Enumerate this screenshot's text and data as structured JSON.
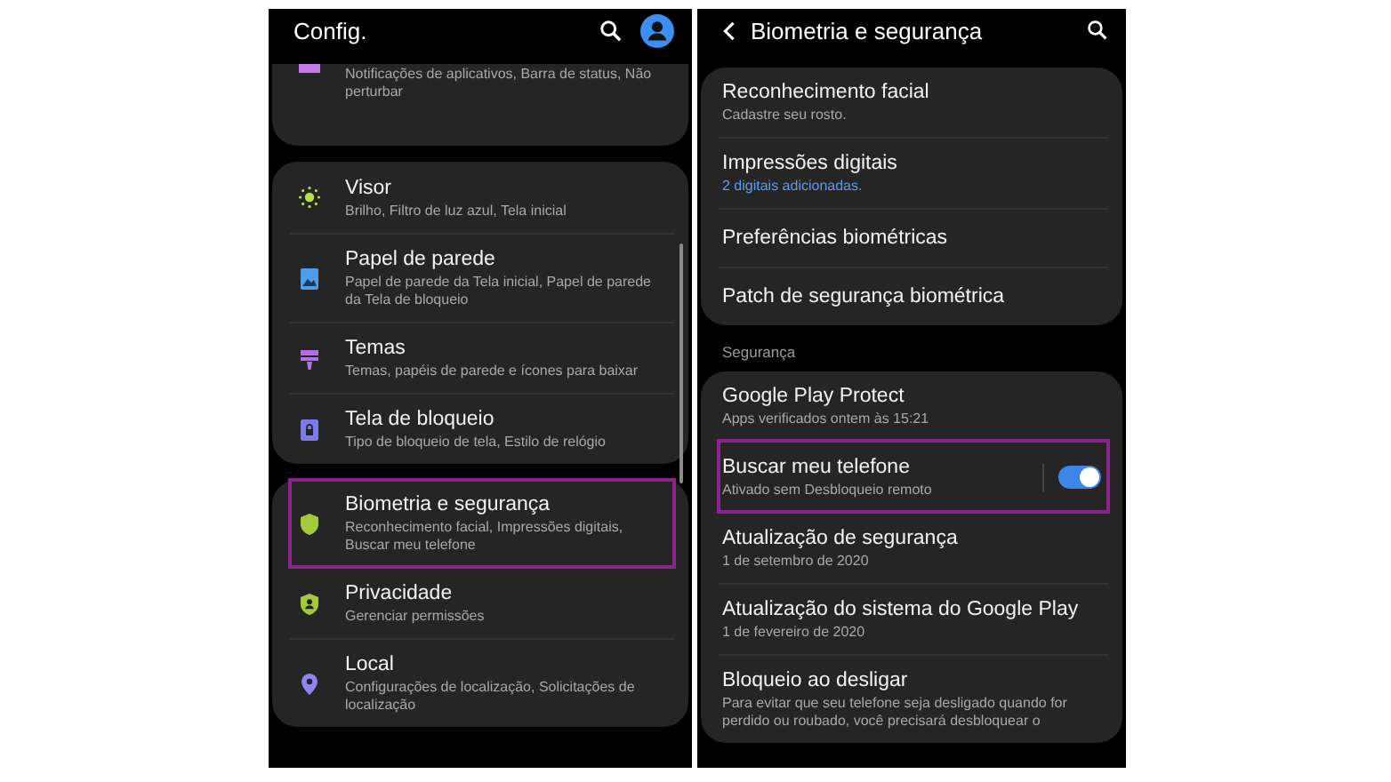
{
  "left": {
    "title": "Config.",
    "cards": [
      {
        "items": [
          {
            "kind": "folder",
            "color": "#c47be8",
            "subtitle": "Notificações de aplicativos, Barra de status, Não perturbar",
            "highlighted": false
          }
        ]
      },
      {
        "items": [
          {
            "kind": "sun",
            "color": "#b9e04a",
            "title": "Visor",
            "subtitle": "Brilho, Filtro de luz azul, Tela inicial",
            "highlighted": false
          },
          {
            "kind": "image",
            "color": "#4d9de8",
            "title": "Papel de parede",
            "subtitle": "Papel de parede da Tela inicial, Papel de parede da Tela de bloqueio",
            "highlighted": false
          },
          {
            "kind": "brush",
            "color": "#b36ee8",
            "title": "Temas",
            "subtitle": "Temas, papéis de parede e ícones para baixar",
            "highlighted": false
          },
          {
            "kind": "lock",
            "color": "#7d7ae8",
            "title": "Tela de bloqueio",
            "subtitle": "Tipo de bloqueio de tela, Estilo de relógio",
            "highlighted": false
          }
        ]
      },
      {
        "items": [
          {
            "kind": "shield",
            "color": "#a3c93a",
            "title": "Biometria e segurança",
            "subtitle": "Reconhecimento facial, Impressões digitais, Buscar meu telefone",
            "highlighted": true
          },
          {
            "kind": "privacy",
            "color": "#a3c93a",
            "title": "Privacidade",
            "subtitle": "Gerenciar permissões",
            "highlighted": false
          },
          {
            "kind": "pin",
            "color": "#8f84f0",
            "title": "Local",
            "subtitle": "Configurações de localização, Solicitações de localização",
            "highlighted": false
          }
        ]
      }
    ]
  },
  "right": {
    "title": "Biometria e segurança",
    "cards": [
      {
        "items": [
          {
            "title": "Reconhecimento facial",
            "subtitle": "Cadastre seu rosto.",
            "accent": false,
            "highlighted": false
          },
          {
            "title": "Impressões digitais",
            "subtitle": "2 digitais adicionadas.",
            "accent": true,
            "highlighted": false
          },
          {
            "title": "Preferências biométricas",
            "highlighted": false
          },
          {
            "title": "Patch de segurança biométrica",
            "highlighted": false
          }
        ]
      },
      {
        "header": "Segurança",
        "items": [
          {
            "title": "Google Play Protect",
            "subtitle": "Apps verificados ontem às 15:21",
            "accent": false,
            "highlighted": false
          },
          {
            "title": "Buscar meu telefone",
            "subtitle": "Ativado sem Desbloqueio remoto",
            "accent": false,
            "highlighted": true,
            "switch": {
              "on": true
            }
          },
          {
            "title": "Atualização de segurança",
            "subtitle": "1 de setembro de 2020",
            "accent": false,
            "highlighted": false
          },
          {
            "title": "Atualização do sistema do Google Play",
            "subtitle": "1 de fevereiro de 2020",
            "accent": false,
            "highlighted": false
          },
          {
            "title": "Bloqueio ao desligar",
            "subtitle": "Para evitar que seu telefone seja desligado quando for perdido ou roubado, você precisará desbloquear o",
            "accent": false,
            "highlighted": false
          }
        ]
      }
    ]
  }
}
